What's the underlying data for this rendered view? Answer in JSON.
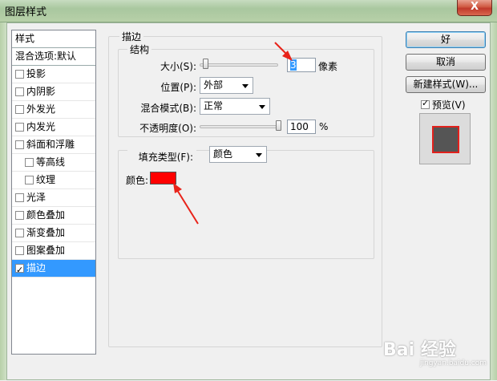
{
  "window": {
    "title": "图层样式",
    "close_label": "X"
  },
  "sidebar": {
    "header": "样式",
    "blend_default": "混合选项:默认",
    "items": [
      {
        "label": "投影",
        "checked": false,
        "indent": false
      },
      {
        "label": "内阴影",
        "checked": false,
        "indent": false
      },
      {
        "label": "外发光",
        "checked": false,
        "indent": false
      },
      {
        "label": "内发光",
        "checked": false,
        "indent": false
      },
      {
        "label": "斜面和浮雕",
        "checked": false,
        "indent": false
      },
      {
        "label": "等高线",
        "checked": false,
        "indent": true
      },
      {
        "label": "纹理",
        "checked": false,
        "indent": true
      },
      {
        "label": "光泽",
        "checked": false,
        "indent": false
      },
      {
        "label": "颜色叠加",
        "checked": false,
        "indent": false
      },
      {
        "label": "渐变叠加",
        "checked": false,
        "indent": false
      },
      {
        "label": "图案叠加",
        "checked": false,
        "indent": false
      },
      {
        "label": "描边",
        "checked": true,
        "indent": false,
        "selected": true
      }
    ]
  },
  "stroke": {
    "group_title": "描边",
    "structure_title": "结构",
    "size_label": "大小(S):",
    "size_value": "3",
    "size_unit": "像素",
    "position_label": "位置(P):",
    "position_value": "外部",
    "blend_label": "混合模式(B):",
    "blend_value": "正常",
    "opacity_label": "不透明度(O):",
    "opacity_value": "100",
    "opacity_unit": "%",
    "fill_type_label": "填充类型(F):",
    "fill_type_value": "颜色",
    "color_label": "颜色:",
    "color_hex": "#ff0000"
  },
  "buttons": {
    "ok": "好",
    "cancel": "取消",
    "new_style": "新建样式(W)...",
    "preview_label": "预览(V)",
    "preview_checked": true
  },
  "colors": {
    "selection": "#3399ff",
    "annotation_arrow": "#e8231a",
    "stroke_color": "#ff0000"
  },
  "watermark": {
    "text": "Bai 经验",
    "sub": "jingyan.baidu.com"
  }
}
